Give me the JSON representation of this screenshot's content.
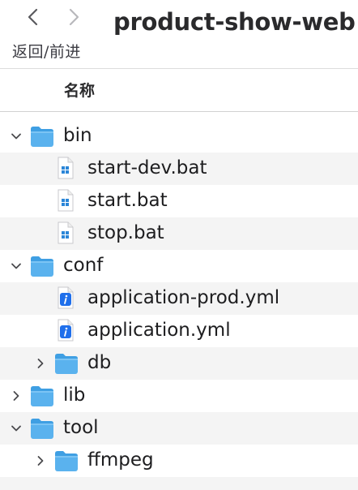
{
  "toolbar": {
    "nav_caption": "返回/前进",
    "window_title": "product-show-web"
  },
  "list_header": {
    "name_column": "名称"
  },
  "tree": [
    {
      "name": "bin",
      "kind": "folder",
      "depth": 0,
      "expanded": true,
      "icon": "folder-icon"
    },
    {
      "name": "start-dev.bat",
      "kind": "file",
      "depth": 1,
      "icon": "windows-batch-file-icon"
    },
    {
      "name": "start.bat",
      "kind": "file",
      "depth": 1,
      "icon": "windows-batch-file-icon"
    },
    {
      "name": "stop.bat",
      "kind": "file",
      "depth": 1,
      "icon": "windows-batch-file-icon"
    },
    {
      "name": "conf",
      "kind": "folder",
      "depth": 0,
      "expanded": true,
      "icon": "folder-icon"
    },
    {
      "name": "application-prod.yml",
      "kind": "file",
      "depth": 1,
      "icon": "info-document-icon"
    },
    {
      "name": "application.yml",
      "kind": "file",
      "depth": 1,
      "icon": "info-document-icon"
    },
    {
      "name": "db",
      "kind": "folder",
      "depth": 1,
      "expanded": false,
      "icon": "folder-icon"
    },
    {
      "name": "lib",
      "kind": "folder",
      "depth": 0,
      "expanded": false,
      "icon": "folder-icon"
    },
    {
      "name": "tool",
      "kind": "folder",
      "depth": 0,
      "expanded": true,
      "icon": "folder-icon"
    },
    {
      "name": "ffmpeg",
      "kind": "folder",
      "depth": 1,
      "expanded": false,
      "icon": "folder-icon"
    }
  ],
  "colors": {
    "folder": "#5ab2ee",
    "folder_tab": "#3f9fe3",
    "stripe": "#f4f4f4",
    "windows_logo": "#2b86d8",
    "info_badge": "#1f6feb"
  }
}
